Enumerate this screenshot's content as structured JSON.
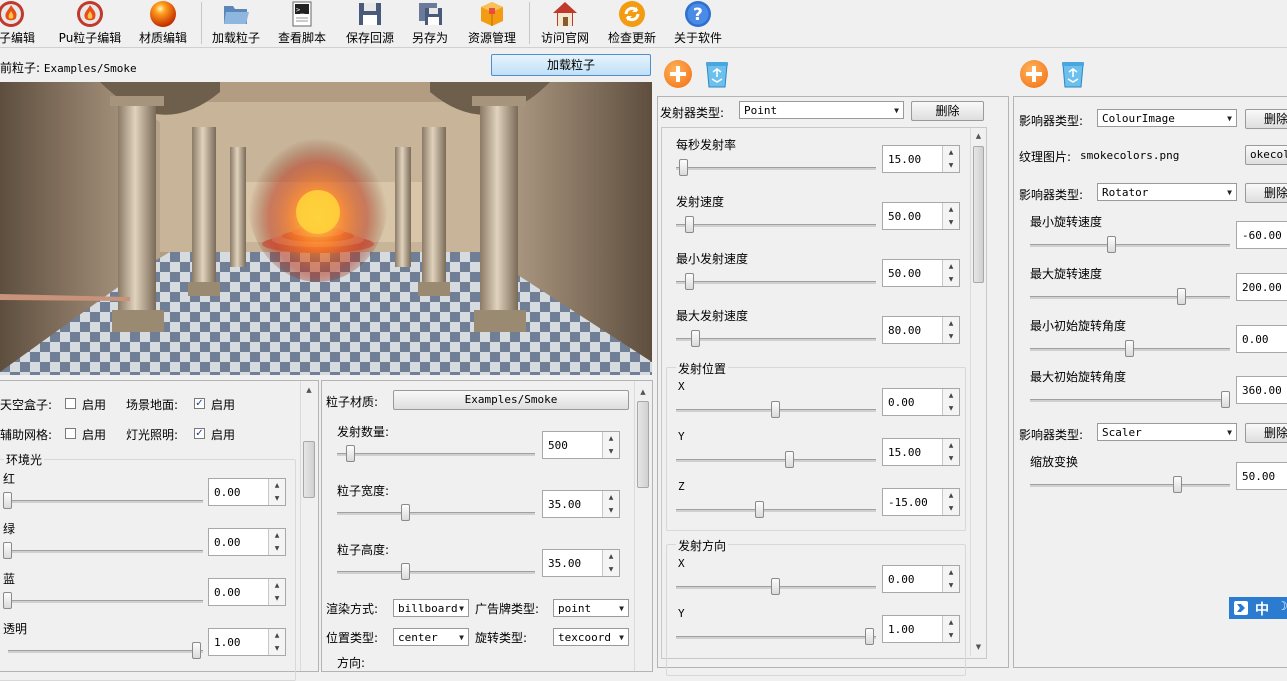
{
  "toolbar": {
    "items": [
      {
        "label": "粒子编辑",
        "icon": "fire-icon"
      },
      {
        "label": "Pu粒子编辑",
        "icon": "fire-icon"
      },
      {
        "label": "材质编辑",
        "icon": "sphere-icon"
      },
      {
        "label": "加载粒子",
        "icon": "folder-open-icon"
      },
      {
        "label": "查看脚本",
        "icon": "script-icon"
      },
      {
        "label": "保存回源",
        "icon": "save-icon"
      },
      {
        "label": "另存为",
        "icon": "save-as-icon"
      },
      {
        "label": "资源管理",
        "icon": "package-icon"
      },
      {
        "label": "访问官网",
        "icon": "home-icon"
      },
      {
        "label": "检查更新",
        "icon": "refresh-icon"
      },
      {
        "label": "关于软件",
        "icon": "help-icon"
      }
    ]
  },
  "current": {
    "label": "前粒子:",
    "value": "Examples/Smoke",
    "load_button": "加载粒子"
  },
  "scene": {
    "rows": [
      {
        "a_label": "天空盒子:",
        "a_check": "启用",
        "a_checked": false,
        "b_label": "场景地面:",
        "b_check": "启用",
        "b_checked": true
      },
      {
        "a_label": "辅助网格:",
        "a_check": "启用",
        "a_checked": false,
        "b_label": "灯光照明:",
        "b_check": "启用",
        "b_checked": true
      }
    ],
    "ambient": {
      "title": "环境光",
      "channels": [
        {
          "label": "红",
          "value": "0.00",
          "level": 0
        },
        {
          "label": "绿",
          "value": "0.00",
          "level": 0
        },
        {
          "label": "蓝",
          "value": "0.00",
          "level": 0
        },
        {
          "label": "透明",
          "value": "1.00",
          "level": 1
        }
      ]
    }
  },
  "material": {
    "label": "粒子材质:",
    "button": "Examples/Smoke",
    "fields": [
      {
        "label": "发射数量:",
        "value": "500",
        "level": 0.07
      },
      {
        "label": "粒子宽度:",
        "value": "35.00",
        "level": 0.35
      },
      {
        "label": "粒子高度:",
        "value": "35.00",
        "level": 0.35
      }
    ],
    "combos": [
      {
        "label": "渲染方式:",
        "value": "billboard",
        "label2": "广告牌类型:",
        "value2": "point"
      },
      {
        "label": "位置类型:",
        "value": "center",
        "label2": "旋转类型:",
        "value2": "texcoord"
      }
    ],
    "partial": "方向:"
  },
  "emitter": {
    "type_label": "发射器类型:",
    "type_value": "Point",
    "delete": "删除",
    "rates": [
      {
        "label": "每秒发射率",
        "value": "15.00",
        "level": 0.04
      },
      {
        "label": "发射速度",
        "value": "50.00",
        "level": 0.07
      },
      {
        "label": "最小发射速度",
        "value": "50.00",
        "level": 0.07
      },
      {
        "label": "最大发射速度",
        "value": "80.00",
        "level": 0.1
      }
    ],
    "position": {
      "title": "发射位置",
      "axes": [
        {
          "label": "X",
          "value": "0.00",
          "level": 0.5
        },
        {
          "label": "Y",
          "value": "15.00",
          "level": 0.57
        },
        {
          "label": "Z",
          "value": "-15.00",
          "level": 0.42
        }
      ]
    },
    "direction": {
      "title": "发射方向",
      "axes": [
        {
          "label": "X",
          "value": "0.00",
          "level": 0.5
        },
        {
          "label": "Y",
          "value": "1.00",
          "level": 0.99
        }
      ]
    }
  },
  "affectors": {
    "type_label": "影响器类型:",
    "delete": "删除",
    "colour": {
      "type": "ColourImage",
      "tex_label": "纹理图片:",
      "tex_value": "smokecolors.png",
      "tex_button": "okecolo"
    },
    "rotator": {
      "type": "Rotator",
      "fields": [
        {
          "label": "最小旋转速度",
          "value": "-60.00",
          "level": 0.41
        },
        {
          "label": "最大旋转速度",
          "value": "200.00",
          "level": 0.76
        },
        {
          "label": "最小初始旋转角度",
          "value": "0.00",
          "level": 0.5
        },
        {
          "label": "最大初始旋转角度",
          "value": "360.00",
          "level": 0.98
        }
      ]
    },
    "scaler": {
      "type": "Scaler",
      "fields": [
        {
          "label": "缩放变换",
          "value": "50.00",
          "level": 0.74
        }
      ]
    }
  },
  "ime": {
    "label": "中"
  }
}
